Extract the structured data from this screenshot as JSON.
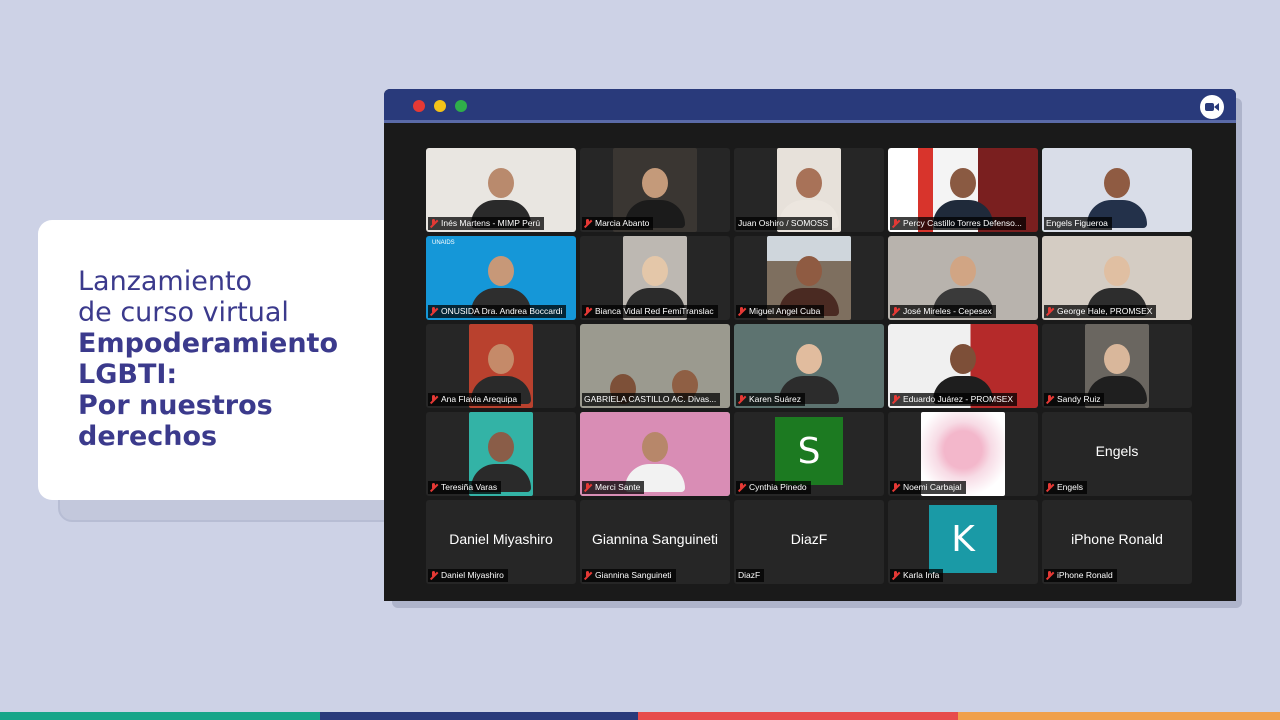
{
  "card": {
    "line1": "Lanzamiento",
    "line2": "de curso virtual",
    "line3": "Empoderamiento",
    "line4": "LGBTI:",
    "line5": "Por nuestros",
    "line6": "derechos"
  },
  "colors": {
    "background": "#cdd2e6",
    "title_text": "#3b3a8c",
    "titlebar": "#293a7b",
    "stripe": [
      "#17a589",
      "#293a7b",
      "#e74c4c",
      "#f0a04b"
    ]
  },
  "window": {
    "icons": [
      "close-dot",
      "minimize-dot",
      "maximize-dot",
      "video-camera-icon"
    ]
  },
  "participants": [
    {
      "name": "Inés Martens - MIMP Perú"
    },
    {
      "name": "Marcia Abanto"
    },
    {
      "name": "Juan Oshiro / SOMOSS"
    },
    {
      "name": "Percy Castillo Torres Defenso..."
    },
    {
      "name": "Engels Figueroa"
    },
    {
      "name": "ONUSIDA Dra. Andrea Boccardi",
      "bg_label": "UNAIDS"
    },
    {
      "name": "Bianca Vidal Red FemiTranslac"
    },
    {
      "name": "Miguel Angel Cuba"
    },
    {
      "name": "José Mireles - Cepesex"
    },
    {
      "name": "George Hale, PROMSEX"
    },
    {
      "name": "Ana Flavia Arequipa"
    },
    {
      "name": "GABRIELA CASTILLO AC. Divas..."
    },
    {
      "name": "Karen Suárez"
    },
    {
      "name": "Eduardo Juárez - PROMSEX"
    },
    {
      "name": "Sandy Ruiz"
    },
    {
      "name": "Teresiña Varas"
    },
    {
      "name": "Merci Sante"
    },
    {
      "name": "Cynthia Pinedo",
      "avatar_letter": "S"
    },
    {
      "name": "Noemi Carbajal"
    },
    {
      "name": "Engels",
      "display": "Engels"
    },
    {
      "name": "Daniel Miyashiro",
      "display": "Daniel Miyashiro"
    },
    {
      "name": "Giannina Sanguineti",
      "display": "Giannina Sanguineti"
    },
    {
      "name": "DiazF",
      "display": "DiazF"
    },
    {
      "name": "Karla Infa",
      "avatar_letter": "K"
    },
    {
      "name": "iPhone Ronald",
      "display": "iPhone Ronald"
    }
  ]
}
